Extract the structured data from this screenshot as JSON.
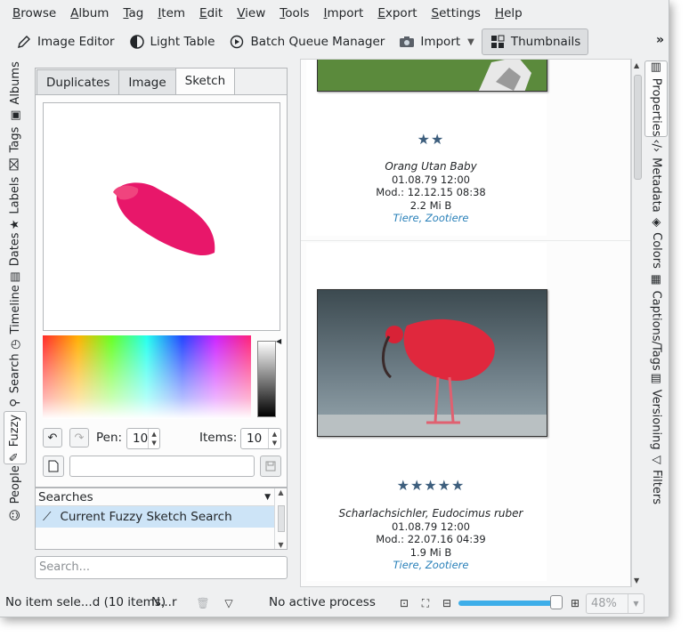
{
  "menubar": {
    "items": [
      {
        "accel": "B",
        "rest": "rowse"
      },
      {
        "accel": "A",
        "rest": "lbum"
      },
      {
        "accel": "T",
        "rest": "ag"
      },
      {
        "accel": "I",
        "rest": "tem"
      },
      {
        "accel": "E",
        "rest": "dit"
      },
      {
        "accel": "V",
        "rest": "iew"
      },
      {
        "accel": "T",
        "rest": "ools"
      },
      {
        "accel": "I",
        "rest": "mport"
      },
      {
        "accel": "E",
        "rest": "xport"
      },
      {
        "accel": "S",
        "rest": "ettings"
      },
      {
        "accel": "H",
        "rest": "elp"
      }
    ]
  },
  "toolbar": {
    "image_editor": "Image Editor",
    "light_table": "Light Table",
    "batch_queue": "Batch Queue Manager",
    "import": "Import",
    "thumbnails": "Thumbnails",
    "more": "»"
  },
  "left_tabs": [
    "Albums",
    "Tags",
    "Labels",
    "Dates",
    "Timeline",
    "Search",
    "Fuzzy",
    "People"
  ],
  "fuzzy": {
    "tabs": [
      "Duplicates",
      "Image",
      "Sketch"
    ],
    "selected_tab": "Sketch",
    "pen_label": "Pen:",
    "pen_value": "10",
    "items_label": "Items:",
    "items_value": "10",
    "sketch_name_value": "",
    "searches_header": "Searches",
    "searches": [
      "Current Fuzzy Sketch Search"
    ],
    "search_placeholder": "Search...",
    "sketch_color": "#e8176a"
  },
  "thumbnails": [
    {
      "stars": "★★",
      "rating": 2,
      "title": "Orang Utan Baby",
      "date": "01.08.79 12:00",
      "modified": "Mod.: 12.12.15 08:38",
      "size": "2.2 Mi B",
      "tags": "Tiere, Zootiere"
    },
    {
      "stars": "★★★★★",
      "rating": 5,
      "title": "Scharlachsichler, Eudocimus ruber",
      "date": "01.08.79 12:00",
      "modified": "Mod.: 22.07.16 04:39",
      "size": "1.9 Mi B",
      "tags": "Tiere, Zootiere"
    }
  ],
  "right_tabs": [
    "Properties",
    "Metadata",
    "Colors",
    "Captions/Tags",
    "Versioning",
    "Filters"
  ],
  "statusbar": {
    "selection": "No item sele...d (10 items)",
    "filter": "N...r",
    "process": "No active process",
    "zoom": "48%"
  },
  "colors": {
    "accent": "#3daee9",
    "star": "#3d5e7d",
    "tag_link": "#2980b9",
    "selected_row": "#cde4f7"
  }
}
